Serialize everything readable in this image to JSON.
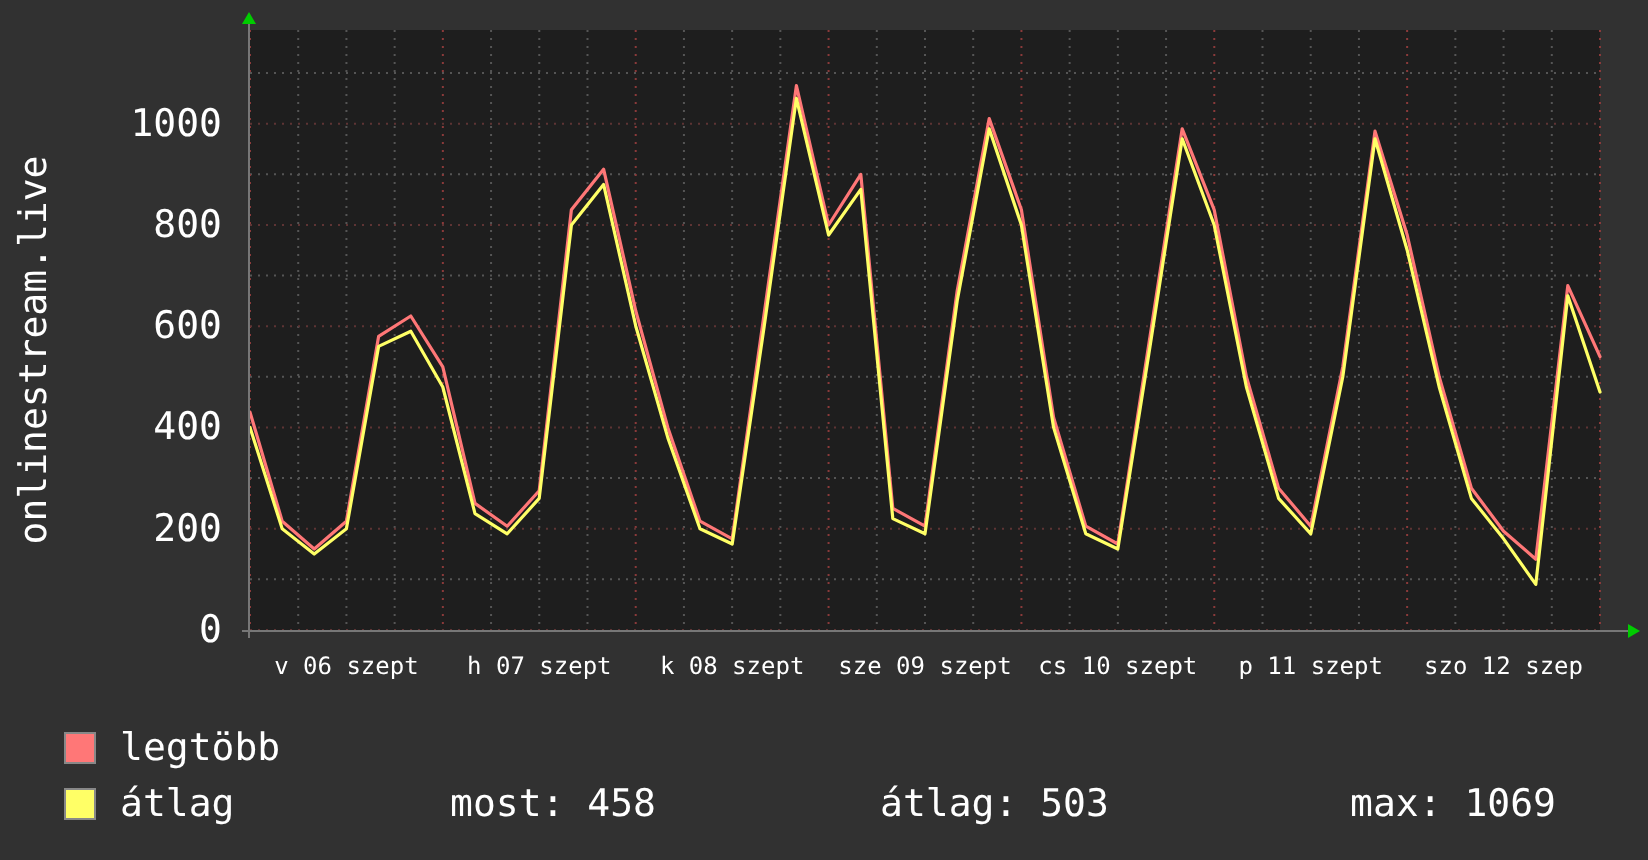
{
  "chart": {
    "chart_data": {
      "type": "line",
      "ylabel": "onlinestream.live",
      "categories": [
        null,
        null,
        null,
        "v 06 szept",
        null,
        null,
        null,
        null,
        null,
        "h 07 szept",
        null,
        null,
        null,
        null,
        null,
        "k 08 szept",
        null,
        null,
        null,
        null,
        null,
        "sze 09 szept",
        null,
        null,
        null,
        null,
        null,
        "cs 10 szept",
        null,
        null,
        null,
        null,
        null,
        "p 11 szept",
        null,
        null,
        null,
        null,
        null,
        "szo 12 szep",
        null,
        null,
        null
      ],
      "grid": true,
      "series": [
        {
          "name": "legtöbb",
          "color": "#ff7777",
          "values": [
            430,
            215,
            160,
            215,
            580,
            620,
            520,
            250,
            205,
            275,
            830,
            910,
            630,
            400,
            215,
            180,
            625,
            1075,
            800,
            900,
            240,
            205,
            670,
            1010,
            830,
            420,
            205,
            170,
            580,
            990,
            830,
            500,
            280,
            205,
            520,
            985,
            780,
            500,
            280,
            195,
            140,
            680,
            540
          ]
        },
        {
          "name": "átlag",
          "color": "#ffff66",
          "values": [
            400,
            200,
            150,
            200,
            560,
            590,
            480,
            230,
            190,
            260,
            800,
            880,
            600,
            380,
            200,
            170,
            600,
            1050,
            780,
            870,
            220,
            190,
            650,
            990,
            800,
            400,
            190,
            160,
            560,
            970,
            800,
            480,
            260,
            190,
            500,
            970,
            750,
            480,
            260,
            180,
            90,
            660,
            470
          ]
        }
      ],
      "ylim": [
        0,
        1185
      ],
      "yticks": [
        0,
        200,
        400,
        600,
        800,
        1000
      ]
    }
  },
  "legend": {
    "stats": [
      "most: 458",
      "átlag: 503",
      "max: 1069"
    ]
  }
}
